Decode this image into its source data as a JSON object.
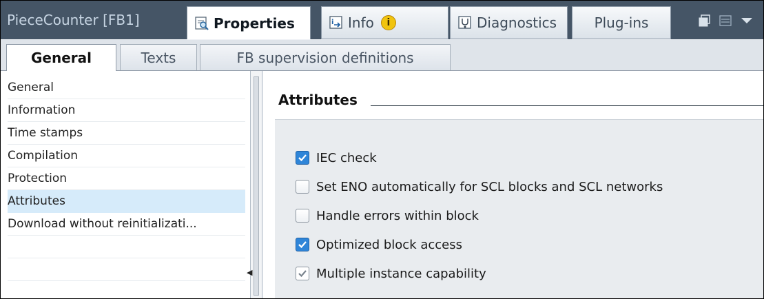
{
  "window": {
    "title": "PieceCounter [FB1]",
    "tabs": [
      {
        "label": "Properties",
        "icon": "properties-icon"
      },
      {
        "label": "Info",
        "icon": "info-icon"
      },
      {
        "label": "Diagnostics",
        "icon": "diagnostics-icon"
      },
      {
        "label": "Plug-ins"
      }
    ],
    "info_badge": "i"
  },
  "subtabs": [
    "General",
    "Texts",
    "FB supervision definitions"
  ],
  "nav": {
    "items": [
      "General",
      "Information",
      "Time stamps",
      "Compilation",
      "Protection",
      "Attributes",
      "Download without reinitializati..."
    ],
    "selected": "Attributes"
  },
  "section": {
    "title": "Attributes",
    "options": [
      {
        "label": "IEC check",
        "checked": true
      },
      {
        "label": "Set ENO automatically for SCL blocks and SCL networks",
        "checked": false
      },
      {
        "label": "Handle errors within block",
        "checked": false
      },
      {
        "label": "Optimized block access",
        "checked": true
      },
      {
        "label": "Multiple instance capability",
        "checked": true,
        "disabled": true
      }
    ]
  },
  "colors": {
    "header_bg": "#455566",
    "checkbox_blue": "#2f85d8",
    "selected_row": "#d6ebfa",
    "panel_bg": "#e9ecef"
  }
}
